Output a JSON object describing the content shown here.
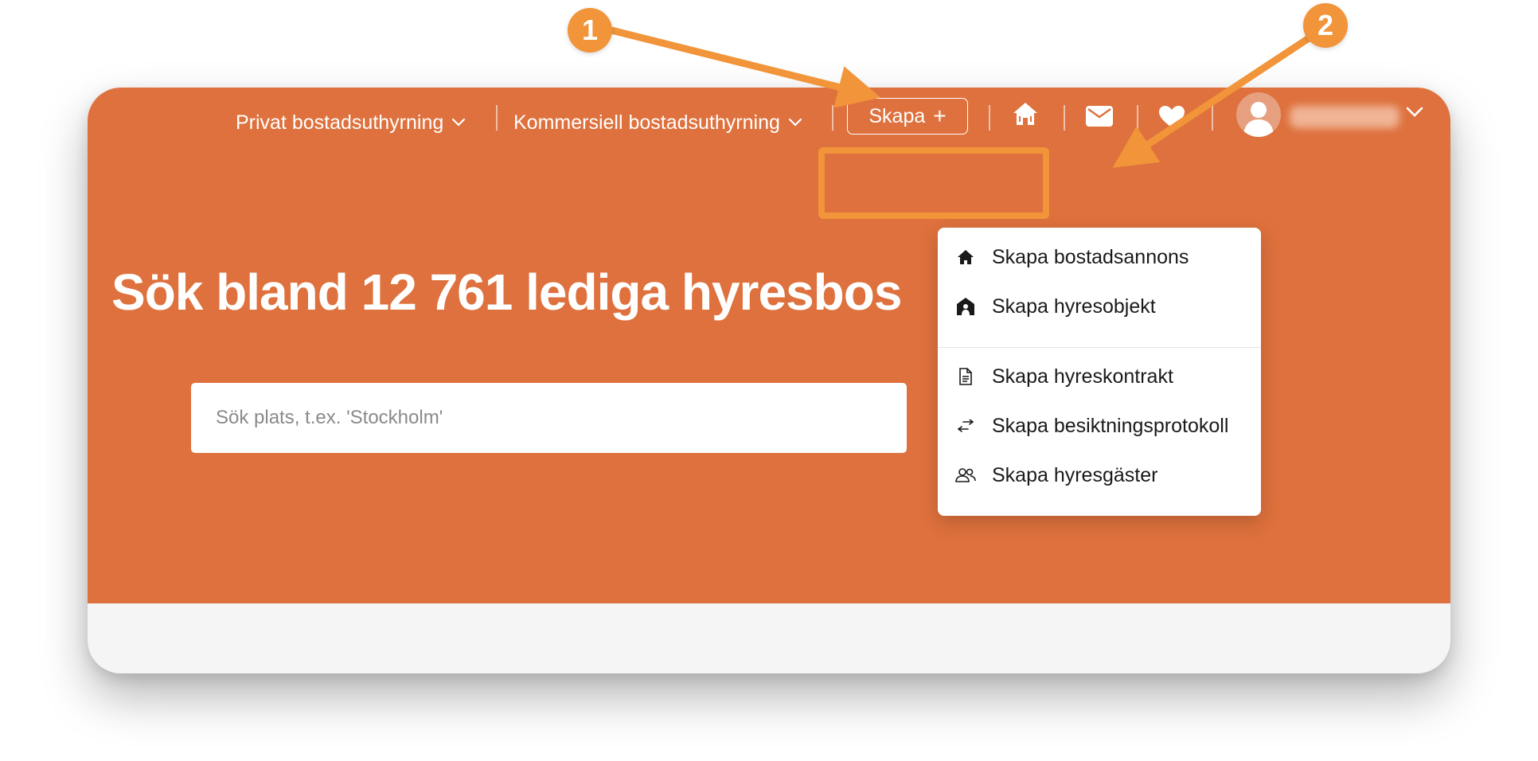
{
  "nav": {
    "private_rental": "Privat bostadsuthyrning",
    "commercial_rental": "Kommersiell bostadsuthyrning",
    "create_label": "Skapa",
    "create_plus": "+"
  },
  "hero": {
    "headline": "Sök bland 12 761 lediga hyresbos",
    "search_placeholder": "Sök plats, t.ex. 'Stockholm'"
  },
  "dropdown": {
    "items": [
      {
        "label": "Skapa bostadsannons",
        "icon": "house-icon"
      },
      {
        "label": "Skapa hyresobjekt",
        "icon": "building-icon"
      },
      {
        "label": "Skapa hyreskontrakt",
        "icon": "document-icon"
      },
      {
        "label": "Skapa besiktningsprotokoll",
        "icon": "swap-arrows-icon"
      },
      {
        "label": "Skapa hyresgäster",
        "icon": "users-icon"
      }
    ]
  },
  "annotations": {
    "badge_1": "1",
    "badge_2": "2"
  },
  "colors": {
    "brand": "#de713d",
    "annotation": "#f1943a"
  }
}
